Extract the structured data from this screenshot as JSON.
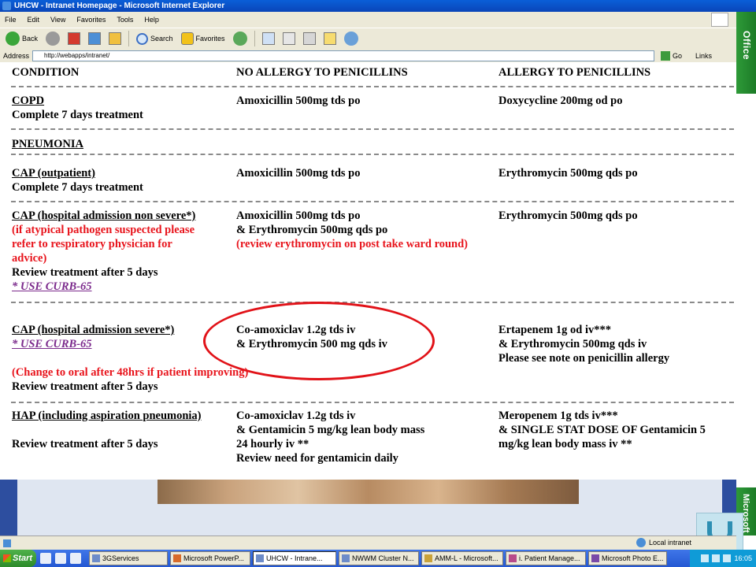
{
  "window": {
    "title": "UHCW - Intranet Homepage - Microsoft Internet Explorer"
  },
  "menu": [
    "File",
    "Edit",
    "View",
    "Favorites",
    "Tools",
    "Help"
  ],
  "toolbar": {
    "back": "Back",
    "search": "Search",
    "favorites": "Favorites"
  },
  "address": {
    "label": "Address",
    "url": "http://webapps/intranet/",
    "go": "Go",
    "links": "Links"
  },
  "office_bar": {
    "top": "Office",
    "bottom": "Microsoft"
  },
  "table": {
    "headers": [
      "CONDITION",
      "NO ALLERGY TO PENICILLINS",
      "ALLERGY TO PENICILLINS"
    ],
    "copd": {
      "name": "COPD",
      "note": "Complete 7 days treatment",
      "no_allergy": "Amoxicillin 500mg tds po",
      "allergy": "Doxycycline 200mg od po"
    },
    "pneumonia_heading": "PNEUMONIA",
    "cap_out": {
      "name": "CAP (outpatient)",
      "note": "Complete 7 days treatment",
      "no_allergy": "Amoxicillin 500mg tds po",
      "allergy": "Erythromycin 500mg qds po"
    },
    "cap_non_severe": {
      "name": "CAP (hospital admission non severe*)",
      "warn1": "(if atypical pathogen suspected please",
      "warn2": "refer to respiratory physician for",
      "warn3": "advice)",
      "review": "Review treatment after 5 days",
      "curb": "* USE CURB-65",
      "no_allergy1": "Amoxicillin 500mg tds po",
      "no_allergy2": "& Erythromycin 500mg qds po",
      "no_allergy3": "(review erythromycin on post take ward round)",
      "allergy": "Erythromycin 500mg qds po"
    },
    "cap_severe": {
      "name": "CAP (hospital admission severe*)",
      "curb": "* USE CURB-65",
      "change": "(Change to oral after 48hrs if patient improving)",
      "review": "Review treatment after 5 days",
      "no_allergy1": "Co-amoxiclav 1.2g tds iv",
      "no_allergy2": "& Erythromycin 500 mg qds iv",
      "allergy1": "Ertapenem 1g od iv***",
      "allergy2": "& Erythromycin 500mg qds iv",
      "allergy3": "Please see note on penicillin allergy"
    },
    "hap": {
      "name": "HAP (including aspiration pneumonia)",
      "review": "Review treatment after 5 days",
      "no_allergy1": "Co-amoxiclav 1.2g tds iv",
      "no_allergy2": "& Gentamicin 5 mg/kg lean body mass",
      "no_allergy3": "24 hourly iv **",
      "no_allergy4": "Review need for gentamicin daily",
      "allergy1": "Meropenem 1g tds iv***",
      "allergy2": "& SINGLE STAT DOSE OF Gentamicin 5",
      "allergy3": "mg/kg lean body mass iv **"
    }
  },
  "status": {
    "zone": "Local intranet"
  },
  "taskbar": {
    "start": "Start",
    "tasks": [
      "3GServices",
      "Microsoft PowerP...",
      "UHCW - Intrane...",
      "NWWM Cluster N...",
      "AMM-L - Microsoft...",
      "i. Patient Manage...",
      "Microsoft Photo E..."
    ],
    "clock": "16:05"
  },
  "colors": {
    "accent_red": "#e8141c",
    "link_purple": "#7b2a8c",
    "office_green": "#2e9a38"
  }
}
